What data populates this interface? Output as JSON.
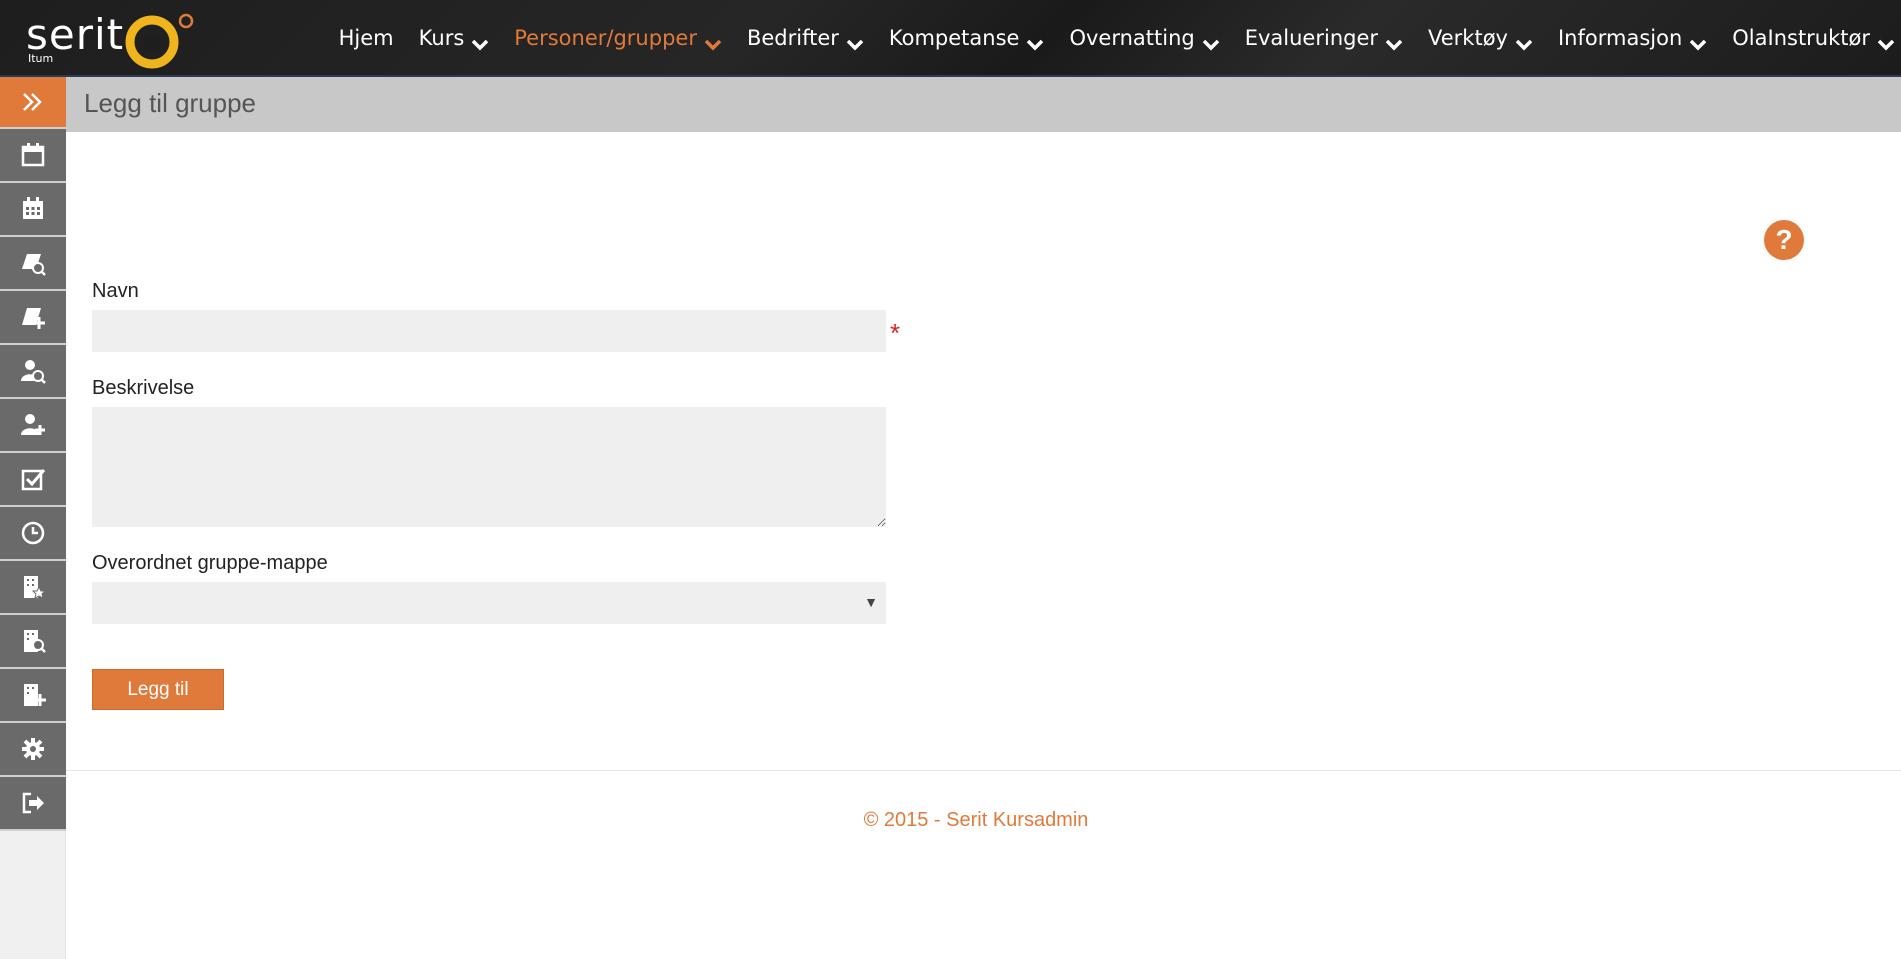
{
  "brand": {
    "name": "serit",
    "sub": "Itum",
    "ring_color": "#f0b41c"
  },
  "nav": {
    "items": [
      {
        "label": "Hjem",
        "has_caret": false,
        "active": false
      },
      {
        "label": "Kurs",
        "has_caret": true,
        "active": false
      },
      {
        "label": "Personer/grupper",
        "has_caret": true,
        "active": true
      },
      {
        "label": "Bedrifter",
        "has_caret": true,
        "active": false
      },
      {
        "label": "Kompetanse",
        "has_caret": true,
        "active": false
      },
      {
        "label": "Overnatting",
        "has_caret": true,
        "active": false
      },
      {
        "label": "Evalueringer",
        "has_caret": true,
        "active": false
      },
      {
        "label": "Verktøy",
        "has_caret": true,
        "active": false
      },
      {
        "label": "Informasjon",
        "has_caret": true,
        "active": false
      },
      {
        "label": "OlaInstruktør",
        "has_caret": true,
        "active": false
      }
    ]
  },
  "sidebar": {
    "toggle_icon": "double-chevron-right-icon",
    "items": [
      {
        "icon": "calendar-icon"
      },
      {
        "icon": "calendar-grid-icon"
      },
      {
        "icon": "course-search-icon"
      },
      {
        "icon": "course-add-icon"
      },
      {
        "icon": "person-search-icon"
      },
      {
        "icon": "person-add-icon"
      },
      {
        "icon": "checkbox-icon"
      },
      {
        "icon": "clock-icon"
      },
      {
        "icon": "building-star-icon"
      },
      {
        "icon": "building-search-icon"
      },
      {
        "icon": "building-add-icon"
      },
      {
        "icon": "gear-icon"
      },
      {
        "icon": "logout-icon"
      }
    ]
  },
  "page": {
    "title": "Legg til gruppe"
  },
  "help": {
    "icon": "question-icon",
    "glyph": "?"
  },
  "form": {
    "name_label": "Navn",
    "name_value": "",
    "required_mark": "*",
    "description_label": "Beskrivelse",
    "description_value": "",
    "parent_label": "Overordnet gruppe-mappe",
    "parent_value": "",
    "submit_label": "Legg til"
  },
  "footer": {
    "text": "© 2015 - Serit Kursadmin"
  },
  "colors": {
    "accent": "#e07a3a",
    "sidebar_btn": "#6a6a6a",
    "header_bg": "#c8c8c8",
    "topbar": "#1e1e1e"
  }
}
